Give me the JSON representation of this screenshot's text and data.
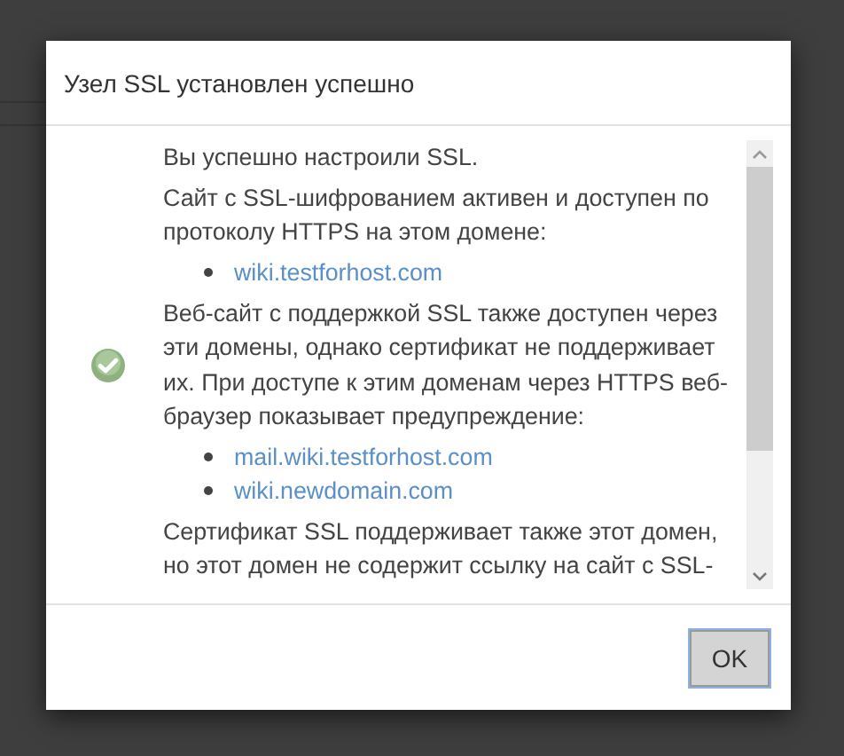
{
  "dialog": {
    "title": "Узел SSL установлен успешно",
    "content": [
      {
        "kind": "text",
        "text": "Вы успешно настроили SSL."
      },
      {
        "kind": "text",
        "text": "Сайт с SSL-шифрованием активен и доступен по протоколу HTTPS на этом домене:"
      },
      {
        "kind": "links",
        "items": [
          "wiki.testforhost.com"
        ]
      },
      {
        "kind": "text",
        "text": "Веб-сайт с поддержкой SSL также доступен через эти домены, однако сертификат не поддерживает их. При доступе к этим доменам через HTTPS веб-браузер показывает предупреждение:"
      },
      {
        "kind": "links",
        "items": [
          "mail.wiki.testforhost.com",
          "wiki.newdomain.com"
        ]
      },
      {
        "kind": "text",
        "text": "Сертификат SSL поддерживает также этот домен, но этот домен не содержит ссылку на сайт с SSL-"
      }
    ],
    "buttons": [
      {
        "label": "OK",
        "focused": true
      }
    ]
  }
}
